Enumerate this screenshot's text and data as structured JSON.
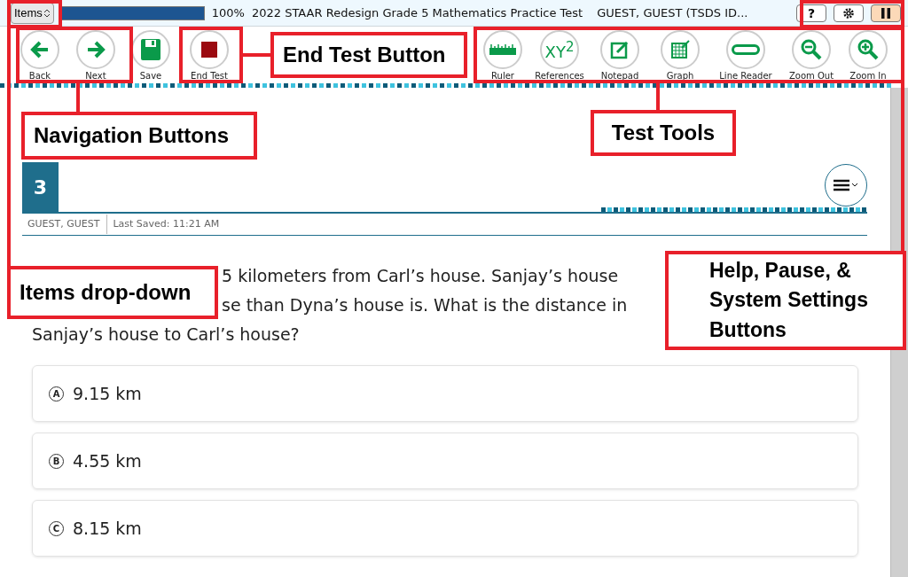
{
  "top_bar": {
    "items_menu": "Items",
    "progress": {
      "level": 1,
      "reading": "100%"
    },
    "test_title": "2022 STAAR Redesign Grade 5 Mathematics Practice Test",
    "user": "GUEST, GUEST (TSDS ID...",
    "system_buttons": [
      {
        "kind": "help",
        "label": "?"
      },
      {
        "kind": "settings"
      },
      {
        "kind": "pause"
      }
    ]
  },
  "nav_buttons": [
    {
      "kind": "back",
      "label": "Back"
    },
    {
      "kind": "next",
      "label": "Next"
    },
    {
      "kind": "save",
      "label": "Save"
    },
    {
      "kind": "end",
      "label": "End Test"
    }
  ],
  "tools": [
    {
      "kind": "ruler",
      "label": "Ruler"
    },
    {
      "kind": "references",
      "label": "References",
      "glyph": "XY$^{2}$"
    },
    {
      "kind": "notepad",
      "label": "Notepad"
    },
    {
      "kind": "graph",
      "label": "Graph"
    },
    {
      "kind": "line-reader",
      "label": "Line Reader"
    },
    {
      "kind": "zoom-out",
      "label": "Zoom Out"
    },
    {
      "kind": "zoom-in",
      "label": "Zoom In"
    }
  ],
  "item": {
    "number": "3",
    "student": "GUEST, GUEST",
    "last_saved": "Last Saved: 11:21 AM"
  },
  "question_lines": [
    {
      "kind": "partial",
      "text": "5 kilometers from Carl’s house. Sanjay’s house"
    },
    {
      "kind": "partial",
      "text": "se than Dyna’s house is. What is the distance in"
    },
    {
      "kind": "full",
      "text": "Sanjay’s house to Carl’s house?"
    }
  ],
  "answers": [
    {
      "letter": "A",
      "text": "9.15 km",
      "selected": false
    },
    {
      "letter": "B",
      "text": "4.55 km",
      "selected": false
    },
    {
      "letter": "C",
      "text": "8.15 km",
      "selected": false
    }
  ],
  "callouts": [
    "End Test Button",
    "Navigation Buttons",
    "Test Tools",
    "Items drop-down",
    "Help, Pause, & System Settings Buttons"
  ]
}
